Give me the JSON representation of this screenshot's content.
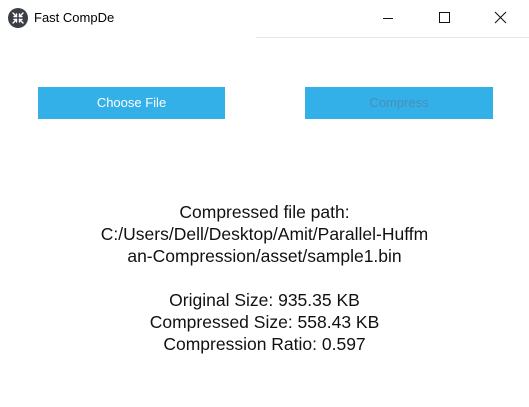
{
  "window": {
    "title": "Fast CompDe",
    "icon": "app-logo-icon",
    "controls": [
      "minimize-icon",
      "maximize-icon",
      "close-icon"
    ]
  },
  "toolbar": {
    "choose_label": "Choose File",
    "compress_label": "Compress"
  },
  "result": {
    "path_heading": "Compressed file path:",
    "path_line1": "C:/Users/Dell/Desktop/Amit/Parallel-Huffm",
    "path_line2": "an-Compression/asset/sample1.bin",
    "original_size": "Original Size: 935.35 KB",
    "compressed_size": "Compressed Size: 558.43 KB",
    "compression_ratio": "Compression Ratio: 0.597"
  },
  "colors": {
    "button_bg": "#33b0e8",
    "button_text": "#ffffff",
    "disabled_text": "#4a8fb5"
  }
}
